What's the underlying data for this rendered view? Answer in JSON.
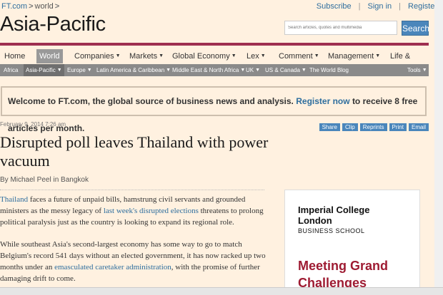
{
  "breadcrumb": {
    "home": "FT.com",
    "section": "world"
  },
  "toplinks": {
    "subscribe": "Subscribe",
    "sign_in": "Sign in",
    "register": "Register"
  },
  "section_title": "Asia-Pacific",
  "search": {
    "placeholder": "Search articles, quotes and multimedia",
    "button": "Search"
  },
  "mainnav": [
    "Home",
    "World",
    "Companies",
    "Markets",
    "Global Economy",
    "Lex",
    "Comment",
    "Management",
    "Life & Arts"
  ],
  "subnav": [
    "Africa",
    "Asia-Pacific",
    "Europe",
    "Latin America & Caribbean",
    "Middle East & North Africa",
    "UK",
    "US & Canada",
    "The World Blog",
    "Tools"
  ],
  "welcome": {
    "pre": "Welcome to FT.com, the global source of business news and analysis.",
    "link": "Register now",
    "post": "to receive 8 free articles per month."
  },
  "article": {
    "date": "February 9, 2014 7:26 am",
    "tools": [
      "Share",
      "Clip",
      "Reprints",
      "Print",
      "Email"
    ],
    "headline": "Disrupted poll leaves Thailand with power vacuum",
    "byline": "By Michael Peel in Bangkok",
    "p1": {
      "link1": "Thailand",
      "t1": "faces a future of unpaid bills, hamstrung civil servants and grounded ministers as the messy legacy of",
      "link2": "last week's disrupted elections",
      "t2": "threatens to prolong political paralysis just as the country is looking to expand its regional role."
    },
    "p2": {
      "t1": "While southeast Asia's second-largest economy has some way to go to match Belgium's record 541 days without an elected government, it has now racked up two months under an",
      "link": "emasculated caretaker administration",
      "t2": ", with the promise of further damaging drift to come."
    }
  },
  "ad": {
    "name": "Imperial College London",
    "school": "BUSINESS SCHOOL",
    "tagline": "Meeting Grand Challenges"
  }
}
